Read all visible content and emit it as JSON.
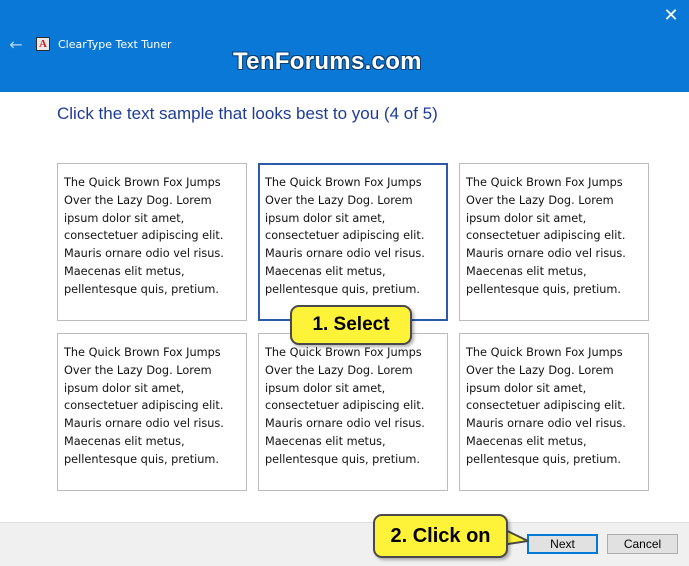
{
  "window": {
    "close_glyph": "✕",
    "back_glyph": "←",
    "app_icon_letter": "A",
    "app_title": "ClearType Text Tuner",
    "watermark": "TenForums.com"
  },
  "heading": "Click the text sample that looks best to you (4 of 5)",
  "samples": [
    {
      "text": "The Quick Brown Fox Jumps Over the Lazy Dog. Lorem ipsum dolor sit amet, consectetuer adipiscing elit. Mauris ornare odio vel risus. Maecenas elit metus, pellentesque quis, pretium."
    },
    {
      "text": "The Quick Brown Fox Jumps Over the Lazy Dog. Lorem ipsum dolor sit amet, consectetuer adipiscing elit. Mauris ornare odio vel risus. Maecenas elit metus, pellentesque quis, pretium."
    },
    {
      "text": "The Quick Brown Fox Jumps Over the Lazy Dog. Lorem ipsum dolor sit amet, consectetuer adipiscing elit. Mauris ornare odio vel risus. Maecenas elit metus, pellentesque quis, pretium."
    },
    {
      "text": "The Quick Brown Fox Jumps Over the Lazy Dog. Lorem ipsum dolor sit amet, consectetuer adipiscing elit. Mauris ornare odio vel risus. Maecenas elit metus, pellentesque quis, pretium."
    },
    {
      "text": "The Quick Brown Fox Jumps Over the Lazy Dog. Lorem ipsum dolor sit amet, consectetuer adipiscing elit. Mauris ornare odio vel risus. Maecenas elit metus, pellentesque quis, pretium."
    },
    {
      "text": "The Quick Brown Fox Jumps Over the Lazy Dog. Lorem ipsum dolor sit amet, consectetuer adipiscing elit. Mauris ornare odio vel risus. Maecenas elit metus, pellentesque quis, pretium."
    }
  ],
  "selected_sample": 2,
  "buttons": {
    "next": "Next",
    "cancel": "Cancel"
  },
  "callouts": {
    "select": "1. Select",
    "click_on": "2. Click on"
  },
  "colors": {
    "title_bar": "#0a78d7",
    "heading": "#1e3c97",
    "selected_border": "#2a5aa8",
    "callout_fill": "#fff33a"
  }
}
